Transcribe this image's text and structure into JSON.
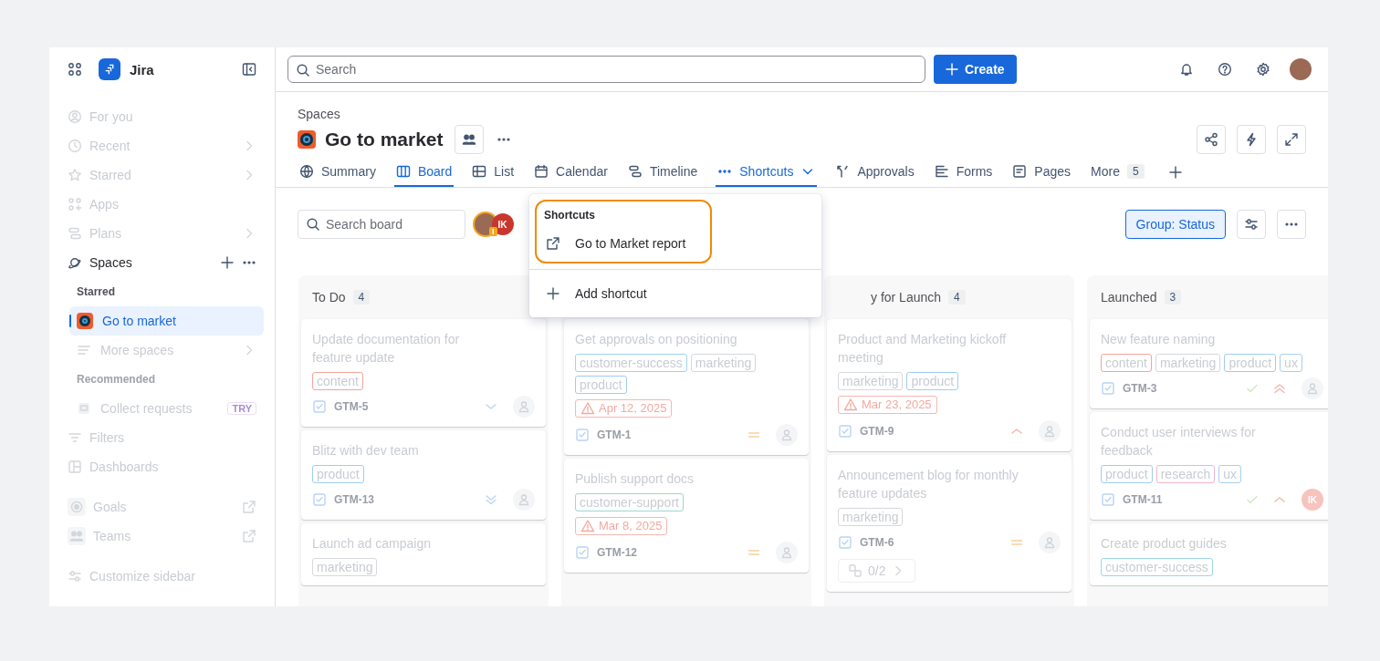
{
  "topbar": {
    "app_name": "Jira",
    "search": {
      "placeholder": "Search"
    },
    "create_button": "Create"
  },
  "sidebar": {
    "items": [
      {
        "kind": "nav",
        "label": "For you",
        "dimmed": true,
        "chevron": false,
        "selected": false
      },
      {
        "kind": "nav",
        "label": "Recent",
        "dimmed": true,
        "chevron": true,
        "selected": false
      },
      {
        "kind": "nav",
        "label": "Starred",
        "dimmed": true,
        "chevron": true,
        "selected": false
      },
      {
        "kind": "nav",
        "label": "Apps",
        "dimmed": true,
        "chevron": false,
        "selected": false
      },
      {
        "kind": "nav",
        "label": "Plans",
        "dimmed": true,
        "chevron": true,
        "selected": false
      },
      {
        "kind": "section",
        "label": "Spaces",
        "dimmed": false,
        "selected": false
      },
      {
        "kind": "heading",
        "label": "Starred",
        "dimmed": false
      },
      {
        "kind": "space",
        "label": "Go to market",
        "dimmed": false,
        "selected": true
      },
      {
        "kind": "sub",
        "label": "More spaces",
        "dimmed": true,
        "chevron": true,
        "selected": false
      },
      {
        "kind": "heading",
        "label": "Recommended",
        "dimmed": true
      },
      {
        "kind": "app",
        "label": "Collect requests",
        "badge": "TRY",
        "dimmed": true,
        "selected": false
      },
      {
        "kind": "nav",
        "label": "Filters",
        "dimmed": true,
        "chevron": false,
        "selected": false
      },
      {
        "kind": "nav",
        "label": "Dashboards",
        "dimmed": true,
        "chevron": false,
        "selected": false
      },
      {
        "kind": "external",
        "label": "Goals",
        "dimmed": true,
        "selected": false
      },
      {
        "kind": "external",
        "label": "Teams",
        "dimmed": true,
        "selected": false
      },
      {
        "kind": "footer",
        "label": "Customize sidebar",
        "dimmed": true,
        "selected": false
      }
    ]
  },
  "header": {
    "breadcrumb": "Spaces",
    "title": "Go to market"
  },
  "tabs": [
    {
      "kind": "view",
      "label": "Summary",
      "selected": false
    },
    {
      "kind": "view",
      "label": "Board",
      "selected": true
    },
    {
      "kind": "view",
      "label": "List",
      "selected": false
    },
    {
      "kind": "view",
      "label": "Calendar",
      "selected": false
    },
    {
      "kind": "view",
      "label": "Timeline",
      "selected": false
    },
    {
      "kind": "menu",
      "label": "Shortcuts",
      "selected": true,
      "expanded": true
    },
    {
      "kind": "view",
      "label": "Approvals",
      "selected": false
    },
    {
      "kind": "view",
      "label": "Forms",
      "selected": false
    },
    {
      "kind": "view",
      "label": "Pages",
      "selected": false
    },
    {
      "kind": "more",
      "label": "More",
      "count": "5",
      "selected": false
    }
  ],
  "shortcuts_menu": {
    "heading": "Shortcuts",
    "spotlight": true,
    "items": [
      {
        "label": "Go to Market report"
      }
    ],
    "action": "Add shortcut"
  },
  "board_toolbar": {
    "search": {
      "placeholder": "Search board"
    },
    "avatars": [
      {
        "kind": "photo",
        "badge": "I"
      },
      {
        "kind": "initials",
        "text": "IK"
      }
    ],
    "group_button": "Group: Status"
  },
  "columns": [
    {
      "title": "To Do",
      "count": "4",
      "cards": [
        {
          "title": "Update documentation for feature update",
          "tags": [
            {
              "label": "content",
              "color": "#f4a49a"
            }
          ],
          "key": "GTM-5",
          "done": false,
          "priority": {
            "kind": "low"
          },
          "assignee": {
            "kind": "empty"
          }
        },
        {
          "title": "Blitz with dev team",
          "tags": [
            {
              "label": "product",
              "color": "#9fcdf2"
            }
          ],
          "key": "GTM-13",
          "done": false,
          "priority": {
            "kind": "lowest"
          },
          "assignee": {
            "kind": "empty"
          }
        },
        {
          "title": "Launch ad campaign",
          "tags": [
            {
              "label": "marketing",
              "color": "#d6d8dc"
            }
          ]
        }
      ]
    },
    {
      "cards": [
        {
          "title": "Get approvals on positioning",
          "tags": [
            {
              "label": "customer-success",
              "color": "#9dd6ea"
            },
            {
              "label": "marketing",
              "color": "#d6d8dc"
            },
            {
              "label": "product",
              "color": "#9fcdf2"
            }
          ],
          "due": "Apr 12, 2025",
          "key": "GTM-1",
          "done": false,
          "priority": {
            "kind": "medium"
          },
          "assignee": {
            "kind": "empty"
          }
        },
        {
          "title": "Publish support docs",
          "tags": [
            {
              "label": "customer-support",
              "color": "#98dccd"
            }
          ],
          "due": "Mar 8, 2025",
          "key": "GTM-12",
          "done": false,
          "priority": {
            "kind": "medium"
          },
          "assignee": {
            "kind": "empty"
          }
        }
      ]
    },
    {
      "title": "y for Launch",
      "count": "4",
      "cards": [
        {
          "title": "Product and Marketing kickoff meeting",
          "tags": [
            {
              "label": "marketing",
              "color": "#d6d8dc"
            },
            {
              "label": "product",
              "color": "#9fcdf2"
            }
          ],
          "due": "Mar 23, 2025",
          "key": "GTM-9",
          "done": false,
          "priority": {
            "kind": "high"
          },
          "assignee": {
            "kind": "empty"
          }
        },
        {
          "title": "Announcement blog for monthly feature updates",
          "tags": [
            {
              "label": "marketing",
              "color": "#d6d8dc"
            }
          ],
          "key": "GTM-6",
          "done": false,
          "priority": {
            "kind": "medium"
          },
          "assignee": {
            "kind": "empty"
          },
          "subtasks": "0/2"
        }
      ]
    },
    {
      "title": "Launched",
      "count": "3",
      "cards": [
        {
          "title": "New feature naming",
          "tags": [
            {
              "label": "content",
              "color": "#f4a49a"
            },
            {
              "label": "marketing",
              "color": "#d6d8dc"
            },
            {
              "label": "product",
              "color": "#9fcdf2"
            },
            {
              "label": "ux",
              "color": "#a6d0f4"
            }
          ],
          "key": "GTM-3",
          "done": true,
          "priority": {
            "kind": "highest"
          },
          "assignee": {
            "kind": "empty"
          }
        },
        {
          "title": "Conduct user interviews for feedback",
          "tags": [
            {
              "label": "product",
              "color": "#9fcdf2"
            },
            {
              "label": "research",
              "color": "#f5b3c8"
            },
            {
              "label": "ux",
              "color": "#a6d0f4"
            }
          ],
          "key": "GTM-11",
          "done": true,
          "priority": {
            "kind": "high"
          },
          "assignee": {
            "kind": "initials",
            "text": "IK"
          }
        },
        {
          "title": "Create product guides",
          "tags": [
            {
              "label": "customer-success",
              "color": "#9dd6ea"
            }
          ]
        }
      ]
    }
  ]
}
